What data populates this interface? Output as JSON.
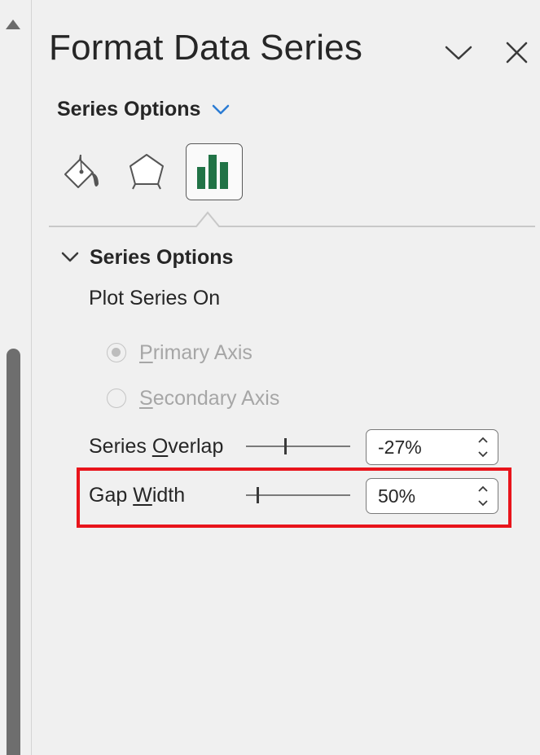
{
  "pane": {
    "title": "Format Data Series",
    "collapse_icon": "chevron-down-icon",
    "close_icon": "close-icon"
  },
  "options_dropdown": {
    "label": "Series Options",
    "accent_color": "#2b7cd3"
  },
  "tabs": [
    {
      "name": "Fill & Line",
      "icon": "paint-bucket-icon",
      "selected": false
    },
    {
      "name": "Effects",
      "icon": "pentagon-icon",
      "selected": false
    },
    {
      "name": "Series Options",
      "icon": "bar-chart-icon",
      "selected": true,
      "icon_color": "#217346"
    }
  ],
  "section": {
    "label": "Series Options",
    "expanded": true,
    "plot_series_on": {
      "label": "Plot Series On",
      "options": [
        {
          "label_parts": [
            "",
            "P",
            "rimary Axis"
          ],
          "checked": true,
          "enabled": false
        },
        {
          "label_parts": [
            "",
            "S",
            "econdary Axis"
          ],
          "checked": false,
          "enabled": false
        }
      ]
    },
    "series_overlap": {
      "label_parts": [
        "Series ",
        "O",
        "verlap"
      ],
      "value": "-27%",
      "slider_fraction": 0.365
    },
    "gap_width": {
      "label_parts": [
        "Gap ",
        "W",
        "idth"
      ],
      "value": "50%",
      "slider_fraction": 0.1,
      "highlighted": true,
      "highlight_color": "#e8141b"
    }
  }
}
